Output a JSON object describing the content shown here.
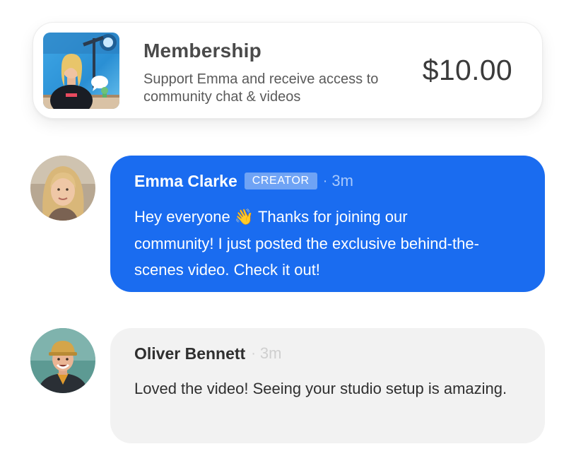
{
  "membership": {
    "title": "Membership",
    "description": "Support Emma and receive access to community chat & videos",
    "price": "$10.00",
    "thumbnail_icon": "creator-studio-photo"
  },
  "messages": [
    {
      "author": "Emma Clarke",
      "badge": "CREATOR",
      "separator": "·",
      "time": "3m",
      "text": "Hey everyone 👋 Thanks for joining our community! I just posted the exclusive behind-the-scenes video. Check it out!",
      "bubble_color": "#1a6cf0"
    },
    {
      "author": "Oliver Bennett",
      "separator": "·",
      "time": "3m",
      "text": "Loved the video! Seeing your studio setup is amazing.",
      "bubble_color": "#f2f2f2"
    }
  ],
  "colors": {
    "accent": "#1a6cf0",
    "badge": "#6fa3f5",
    "muted_bubble": "#f2f2f2"
  }
}
